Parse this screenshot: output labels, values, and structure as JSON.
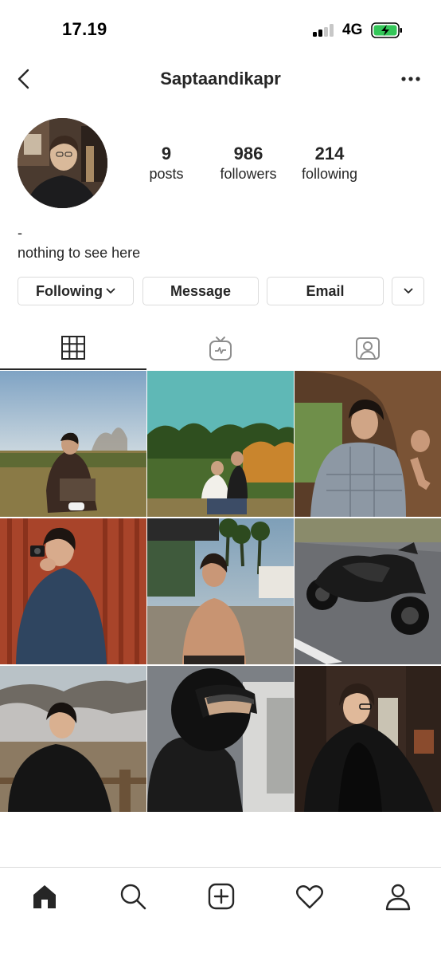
{
  "status_bar": {
    "time": "17.19",
    "network": "4G",
    "icons": [
      "signal-icon",
      "battery-charging-icon"
    ]
  },
  "header": {
    "username": "Saptaandikapr",
    "icons": [
      "back-chevron-icon",
      "more-options-icon"
    ]
  },
  "profile": {
    "stats": [
      {
        "value": "9",
        "label": "posts"
      },
      {
        "value": "986",
        "label": "followers"
      },
      {
        "value": "214",
        "label": "following"
      }
    ],
    "bio_line1": "-",
    "bio_line2": "nothing to see here"
  },
  "actions": {
    "following": "Following",
    "message": "Message",
    "email": "Email"
  },
  "tabs": [
    {
      "icon": "grid-icon",
      "active": true
    },
    {
      "icon": "igtv-icon",
      "active": false
    },
    {
      "icon": "tagged-icon",
      "active": false
    }
  ],
  "posts_count": 9,
  "bottom_nav": [
    "home-icon",
    "search-icon",
    "new-post-icon",
    "activity-heart-icon",
    "profile-icon"
  ],
  "colors": {
    "text": "#262626",
    "border": "#dbdbdb",
    "battery_fill": "#34c759"
  }
}
